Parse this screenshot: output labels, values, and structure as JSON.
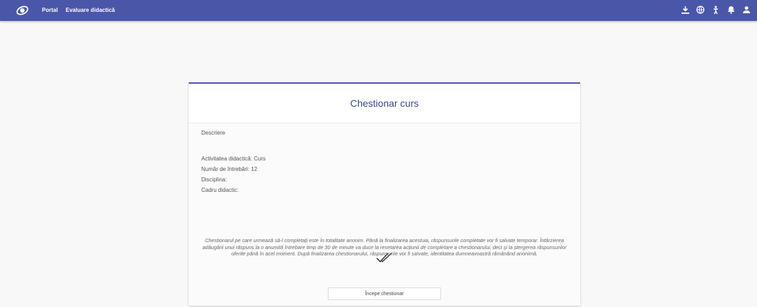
{
  "topbar": {
    "nav": [
      "Portal",
      "Evaluare didactică"
    ],
    "icons": [
      "download-icon",
      "globe-icon",
      "accessibility-icon",
      "bell-icon",
      "user-icon"
    ],
    "color": "#4a57a8"
  },
  "card": {
    "title": "Chestionar curs",
    "description_label": "Descriere",
    "activity": "Activitatea didactică: Curs",
    "questions": "Număr de întrebări: 12",
    "discipline": "Disciplina:",
    "teacher": "Cadru didactic:",
    "note": "Chestionarul pe care urmează să-l completați este în totalitate anonim. Până la finalizarea acestuia, răspunsurile completate vor fi salvate temporar. Întârzierea adăugării unui răspuns la o anumită întrebare timp de 30 de minute va duce la resetarea acțiunii de completare a chestionarului, deci și la ștergerea răspunsurilor oferite până în acel moment. După finalizarea chestionarului, răspunsurile vor fi salvate, identitatea dumneavoastră rămânând anonimă.",
    "start_button": "Începe chestionar"
  }
}
